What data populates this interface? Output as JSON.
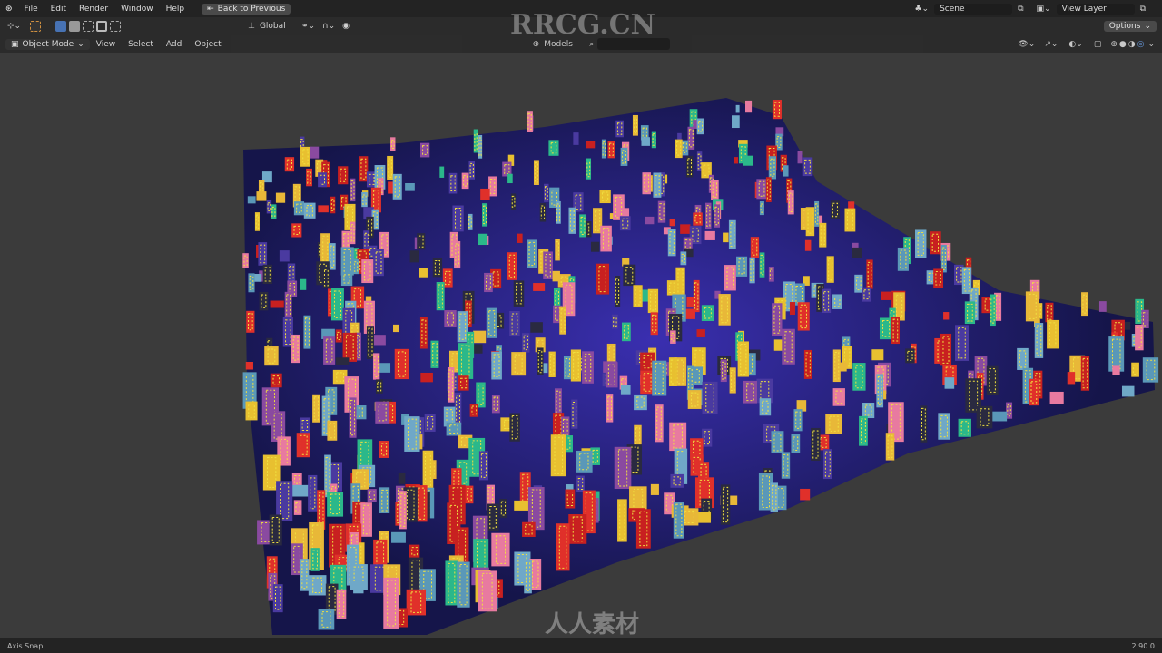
{
  "menu": {
    "items": [
      "File",
      "Edit",
      "Render",
      "Window",
      "Help"
    ],
    "back": "Back to Previous"
  },
  "scene": {
    "label": "Scene",
    "view_layer": "View Layer",
    "options": "Options"
  },
  "header": {
    "mode": "Object Mode",
    "menus": [
      "View",
      "Select",
      "Add",
      "Object"
    ],
    "orientation": "Global",
    "collection": "Models"
  },
  "status": {
    "left": "Axis Snap",
    "version": "2.90.0"
  },
  "watermark": {
    "top": "RRCG.CN",
    "bottom": "人人素材"
  },
  "colors": {
    "plane": "#15154a",
    "glow": "#3a2fb0",
    "buildings": [
      "#e0302a",
      "#c82020",
      "#2bb88a",
      "#6fa8c8",
      "#e8c030",
      "#4a3aa0",
      "#8a4aa0",
      "#e87aa0",
      "#2a2a40",
      "#e8b838",
      "#5a98b8"
    ],
    "window": "#f0e040"
  }
}
